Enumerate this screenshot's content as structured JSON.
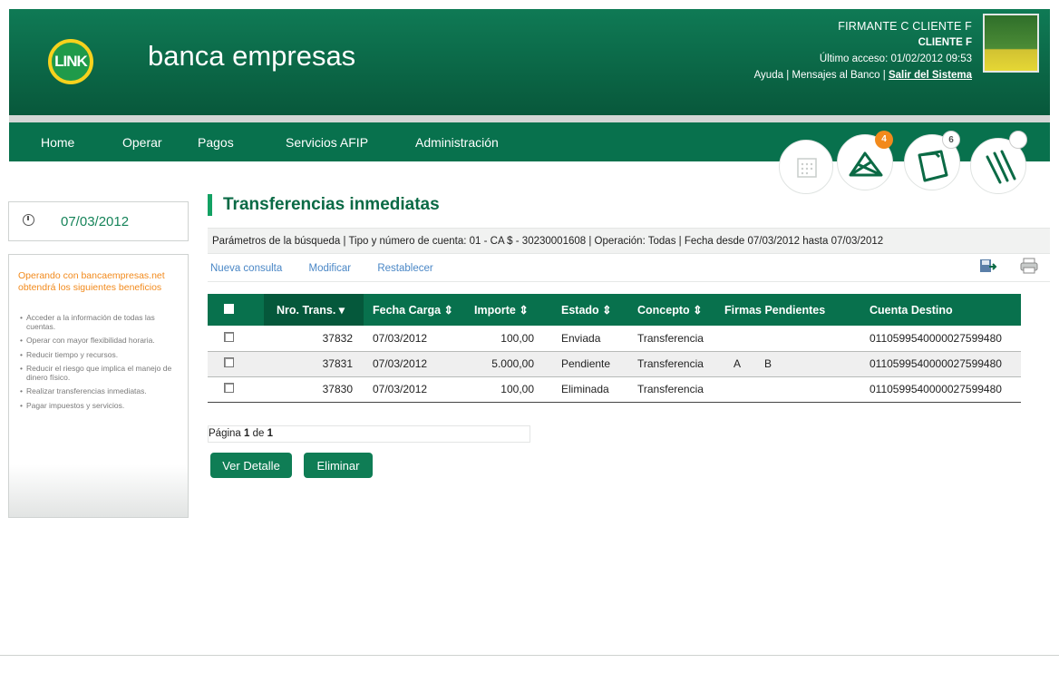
{
  "header": {
    "logo_text": "LINK",
    "brand": "banca empresas",
    "user_name": "FIRMANTE C CLIENTE F",
    "client": "CLIENTE F",
    "last_access": "Último acceso: 01/02/2012 09:53",
    "help": "Ayuda",
    "messages": "Mensajes al Banco",
    "logout": "Salir del Sistema"
  },
  "nav": {
    "items": [
      "Home",
      "Operar",
      "Pagos",
      "Servicios AFIP",
      "Administración"
    ],
    "badges": {
      "envelope": "4",
      "folder": "6"
    }
  },
  "sidebar": {
    "date": "07/03/2012",
    "benefits_title": "Operando con bancaempresas.net obtendrá los siguientes beneficios",
    "benefits": [
      "Acceder a la información de todas las cuentas.",
      "Operar con mayor flexibilidad horaria.",
      "Reducir tiempo y recursos.",
      "Reducir el riesgo que implica el manejo de dinero físico.",
      "Realizar transferencias inmediatas.",
      "Pagar impuestos y servicios."
    ]
  },
  "main": {
    "title": "Transferencias inmediatas",
    "params": "Parámetros de la búsqueda  | Tipo y número de cuenta: 01 - CA $ - 30230001608 | Operación: Todas | Fecha desde 07/03/2012 hasta 07/03/2012",
    "actions": [
      "Nueva consulta",
      "Modificar",
      "Restablecer"
    ],
    "table": {
      "headers": [
        "Nro. Trans.",
        "Fecha Carga",
        "Importe",
        "Estado",
        "Concepto",
        "Firmas Pendientes",
        "Cuenta Destino"
      ],
      "rows": [
        {
          "nro": "37832",
          "fecha": "07/03/2012",
          "importe": "100,00",
          "estado": "Enviada",
          "concepto": "Transferencia",
          "firma_a": "",
          "firma_b": "",
          "cuenta": "0110599540000027599480"
        },
        {
          "nro": "37831",
          "fecha": "07/03/2012",
          "importe": "5.000,00",
          "estado": "Pendiente",
          "concepto": "Transferencia",
          "firma_a": "A",
          "firma_b": "B",
          "cuenta": "0110599540000027599480"
        },
        {
          "nro": "37830",
          "fecha": "07/03/2012",
          "importe": "100,00",
          "estado": "Eliminada",
          "concepto": "Transferencia",
          "firma_a": "",
          "firma_b": "",
          "cuenta": "0110599540000027599480"
        }
      ]
    },
    "pager": {
      "prefix": "Página",
      "page": "1",
      "of": "de",
      "total": "1"
    },
    "buttons": {
      "detail": "Ver Detalle",
      "delete": "Eliminar"
    }
  },
  "colors": {
    "primary": "#08714d",
    "header": "#0f7a55",
    "accent": "#f28a1c",
    "link": "#4a87c6"
  }
}
